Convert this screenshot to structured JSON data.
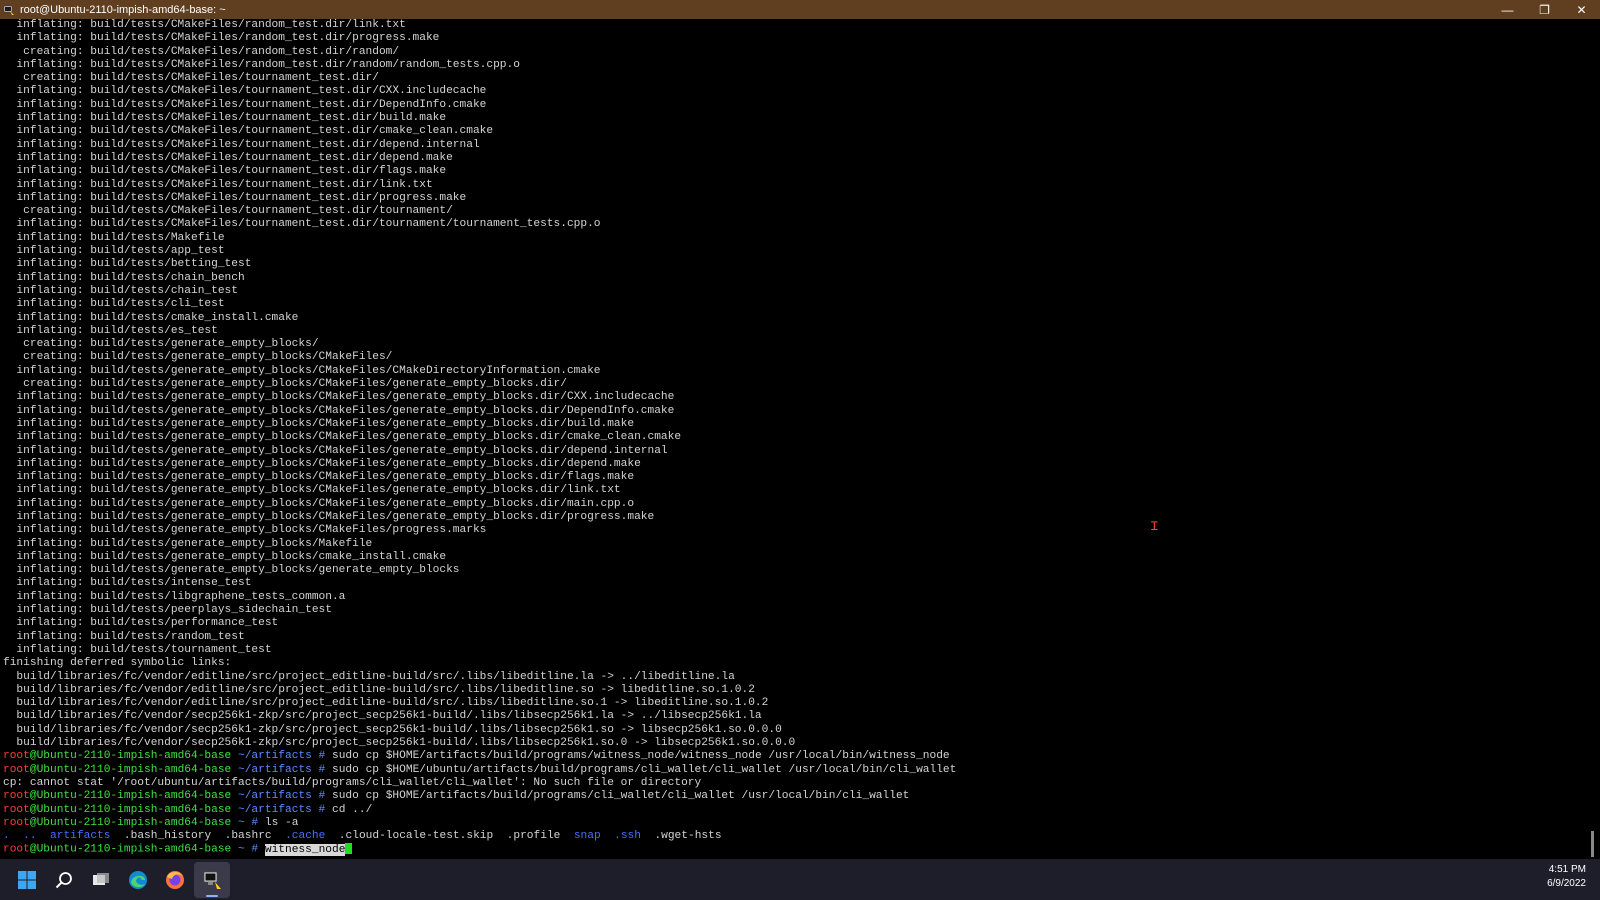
{
  "window": {
    "title": "root@Ubuntu-2110-impish-amd64-base: ~",
    "minimize_label": "—",
    "maximize_label": "❐",
    "close_label": "✕"
  },
  "terminal": {
    "lines": [
      {
        "type": "plain",
        "text": "  inflating: build/tests/CMakeFiles/random_test.dir/link.txt"
      },
      {
        "type": "plain",
        "text": "  inflating: build/tests/CMakeFiles/random_test.dir/progress.make"
      },
      {
        "type": "plain",
        "text": "   creating: build/tests/CMakeFiles/random_test.dir/random/"
      },
      {
        "type": "plain",
        "text": "  inflating: build/tests/CMakeFiles/random_test.dir/random/random_tests.cpp.o"
      },
      {
        "type": "plain",
        "text": "   creating: build/tests/CMakeFiles/tournament_test.dir/"
      },
      {
        "type": "plain",
        "text": "  inflating: build/tests/CMakeFiles/tournament_test.dir/CXX.includecache"
      },
      {
        "type": "plain",
        "text": "  inflating: build/tests/CMakeFiles/tournament_test.dir/DependInfo.cmake"
      },
      {
        "type": "plain",
        "text": "  inflating: build/tests/CMakeFiles/tournament_test.dir/build.make"
      },
      {
        "type": "plain",
        "text": "  inflating: build/tests/CMakeFiles/tournament_test.dir/cmake_clean.cmake"
      },
      {
        "type": "plain",
        "text": "  inflating: build/tests/CMakeFiles/tournament_test.dir/depend.internal"
      },
      {
        "type": "plain",
        "text": "  inflating: build/tests/CMakeFiles/tournament_test.dir/depend.make"
      },
      {
        "type": "plain",
        "text": "  inflating: build/tests/CMakeFiles/tournament_test.dir/flags.make"
      },
      {
        "type": "plain",
        "text": "  inflating: build/tests/CMakeFiles/tournament_test.dir/link.txt"
      },
      {
        "type": "plain",
        "text": "  inflating: build/tests/CMakeFiles/tournament_test.dir/progress.make"
      },
      {
        "type": "plain",
        "text": "   creating: build/tests/CMakeFiles/tournament_test.dir/tournament/"
      },
      {
        "type": "plain",
        "text": "  inflating: build/tests/CMakeFiles/tournament_test.dir/tournament/tournament_tests.cpp.o"
      },
      {
        "type": "plain",
        "text": "  inflating: build/tests/Makefile"
      },
      {
        "type": "plain",
        "text": "  inflating: build/tests/app_test"
      },
      {
        "type": "plain",
        "text": "  inflating: build/tests/betting_test"
      },
      {
        "type": "plain",
        "text": "  inflating: build/tests/chain_bench"
      },
      {
        "type": "plain",
        "text": "  inflating: build/tests/chain_test"
      },
      {
        "type": "plain",
        "text": "  inflating: build/tests/cli_test"
      },
      {
        "type": "plain",
        "text": "  inflating: build/tests/cmake_install.cmake"
      },
      {
        "type": "plain",
        "text": "  inflating: build/tests/es_test"
      },
      {
        "type": "plain",
        "text": "   creating: build/tests/generate_empty_blocks/"
      },
      {
        "type": "plain",
        "text": "   creating: build/tests/generate_empty_blocks/CMakeFiles/"
      },
      {
        "type": "plain",
        "text": "  inflating: build/tests/generate_empty_blocks/CMakeFiles/CMakeDirectoryInformation.cmake"
      },
      {
        "type": "plain",
        "text": "   creating: build/tests/generate_empty_blocks/CMakeFiles/generate_empty_blocks.dir/"
      },
      {
        "type": "plain",
        "text": "  inflating: build/tests/generate_empty_blocks/CMakeFiles/generate_empty_blocks.dir/CXX.includecache"
      },
      {
        "type": "plain",
        "text": "  inflating: build/tests/generate_empty_blocks/CMakeFiles/generate_empty_blocks.dir/DependInfo.cmake"
      },
      {
        "type": "plain",
        "text": "  inflating: build/tests/generate_empty_blocks/CMakeFiles/generate_empty_blocks.dir/build.make"
      },
      {
        "type": "plain",
        "text": "  inflating: build/tests/generate_empty_blocks/CMakeFiles/generate_empty_blocks.dir/cmake_clean.cmake"
      },
      {
        "type": "plain",
        "text": "  inflating: build/tests/generate_empty_blocks/CMakeFiles/generate_empty_blocks.dir/depend.internal"
      },
      {
        "type": "plain",
        "text": "  inflating: build/tests/generate_empty_blocks/CMakeFiles/generate_empty_blocks.dir/depend.make"
      },
      {
        "type": "plain",
        "text": "  inflating: build/tests/generate_empty_blocks/CMakeFiles/generate_empty_blocks.dir/flags.make"
      },
      {
        "type": "plain",
        "text": "  inflating: build/tests/generate_empty_blocks/CMakeFiles/generate_empty_blocks.dir/link.txt"
      },
      {
        "type": "plain",
        "text": "  inflating: build/tests/generate_empty_blocks/CMakeFiles/generate_empty_blocks.dir/main.cpp.o"
      },
      {
        "type": "plain",
        "text": "  inflating: build/tests/generate_empty_blocks/CMakeFiles/generate_empty_blocks.dir/progress.make"
      },
      {
        "type": "plain",
        "text": "  inflating: build/tests/generate_empty_blocks/CMakeFiles/progress.marks"
      },
      {
        "type": "plain",
        "text": "  inflating: build/tests/generate_empty_blocks/Makefile"
      },
      {
        "type": "plain",
        "text": "  inflating: build/tests/generate_empty_blocks/cmake_install.cmake"
      },
      {
        "type": "plain",
        "text": "  inflating: build/tests/generate_empty_blocks/generate_empty_blocks"
      },
      {
        "type": "plain",
        "text": "  inflating: build/tests/intense_test"
      },
      {
        "type": "plain",
        "text": "  inflating: build/tests/libgraphene_tests_common.a"
      },
      {
        "type": "plain",
        "text": "  inflating: build/tests/peerplays_sidechain_test"
      },
      {
        "type": "plain",
        "text": "  inflating: build/tests/performance_test"
      },
      {
        "type": "plain",
        "text": "  inflating: build/tests/random_test"
      },
      {
        "type": "plain",
        "text": "  inflating: build/tests/tournament_test"
      },
      {
        "type": "plain",
        "text": "finishing deferred symbolic links:"
      },
      {
        "type": "plain",
        "text": "  build/libraries/fc/vendor/editline/src/project_editline-build/src/.libs/libeditline.la -> ../libeditline.la"
      },
      {
        "type": "plain",
        "text": "  build/libraries/fc/vendor/editline/src/project_editline-build/src/.libs/libeditline.so -> libeditline.so.1.0.2"
      },
      {
        "type": "plain",
        "text": "  build/libraries/fc/vendor/editline/src/project_editline-build/src/.libs/libeditline.so.1 -> libeditline.so.1.0.2"
      },
      {
        "type": "plain",
        "text": "  build/libraries/fc/vendor/secp256k1-zkp/src/project_secp256k1-build/.libs/libsecp256k1.la -> ../libsecp256k1.la"
      },
      {
        "type": "plain",
        "text": "  build/libraries/fc/vendor/secp256k1-zkp/src/project_secp256k1-build/.libs/libsecp256k1.so -> libsecp256k1.so.0.0.0"
      },
      {
        "type": "plain",
        "text": "  build/libraries/fc/vendor/secp256k1-zkp/src/project_secp256k1-build/.libs/libsecp256k1.so.0 -> libsecp256k1.so.0.0.0"
      },
      {
        "type": "prompt",
        "user": "root",
        "at": "@",
        "host": "Ubuntu-2110-impish-amd64-base",
        "path": " ~/artifacts # ",
        "cmd": "sudo cp $HOME/artifacts/build/programs/witness_node/witness_node /usr/local/bin/witness_node"
      },
      {
        "type": "prompt",
        "user": "root",
        "at": "@",
        "host": "Ubuntu-2110-impish-amd64-base",
        "path": " ~/artifacts # ",
        "cmd": "sudo cp $HOME/ubuntu/artifacts/build/programs/cli_wallet/cli_wallet /usr/local/bin/cli_wallet"
      },
      {
        "type": "plain",
        "text": "cp: cannot stat '/root/ubuntu/artifacts/build/programs/cli_wallet/cli_wallet': No such file or directory"
      },
      {
        "type": "prompt",
        "user": "root",
        "at": "@",
        "host": "Ubuntu-2110-impish-amd64-base",
        "path": " ~/artifacts # ",
        "cmd": "sudo cp $HOME/artifacts/build/programs/cli_wallet/cli_wallet /usr/local/bin/cli_wallet"
      },
      {
        "type": "prompt",
        "user": "root",
        "at": "@",
        "host": "Ubuntu-2110-impish-amd64-base",
        "path": " ~/artifacts # ",
        "cmd": "cd ../"
      },
      {
        "type": "prompt",
        "user": "root",
        "at": "@",
        "host": "Ubuntu-2110-impish-amd64-base",
        "path": " ~ # ",
        "cmd": "ls -a"
      },
      {
        "type": "ls",
        "entries": [
          {
            "name": ".",
            "kind": "dir"
          },
          {
            "name": "..",
            "kind": "dir"
          },
          {
            "name": "artifacts",
            "kind": "dir"
          },
          {
            "name": ".bash_history",
            "kind": "file"
          },
          {
            "name": ".bashrc",
            "kind": "file"
          },
          {
            "name": ".cache",
            "kind": "dir"
          },
          {
            "name": ".cloud-locale-test.skip",
            "kind": "file"
          },
          {
            "name": ".profile",
            "kind": "file"
          },
          {
            "name": "snap",
            "kind": "dir"
          },
          {
            "name": ".ssh",
            "kind": "dir"
          },
          {
            "name": ".wget-hsts",
            "kind": "file"
          }
        ]
      },
      {
        "type": "active",
        "user": "root",
        "at": "@",
        "host": "Ubuntu-2110-impish-amd64-base",
        "path": " ~ # ",
        "cmd": "witness_node"
      }
    ]
  },
  "taskbar": {
    "icons": [
      "windows-start-icon",
      "search-icon",
      "task-view-icon",
      "edge-browser-icon",
      "firefox-icon",
      "putty-terminal-icon"
    ],
    "time": "4:51 PM",
    "date": "6/9/2022"
  },
  "colors": {
    "title_bar": "#603e20",
    "user": "#ff3b3b",
    "host": "#40e040",
    "path": "#5b8cff",
    "directory": "#4a6cff",
    "cursor": "#22dd22",
    "taskbar": "#1e1e2a"
  }
}
